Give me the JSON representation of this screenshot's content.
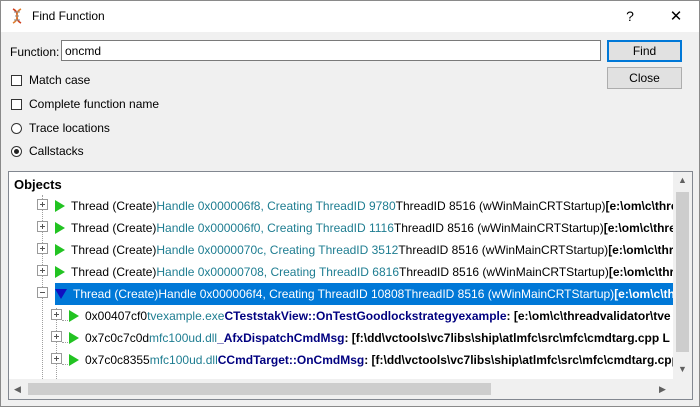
{
  "window": {
    "title": "Find Function",
    "help_glyph": "?",
    "close_glyph": "✕"
  },
  "form": {
    "function_label": "Function:",
    "function_value": "oncmd",
    "find_label": "Find",
    "close_label": "Close",
    "match_case": "Match case",
    "complete_name": "Complete function name",
    "trace_locations": "Trace locations",
    "callstacks": "Callstacks",
    "match_case_checked": false,
    "complete_name_checked": false,
    "selected_radio": "callstacks"
  },
  "objects": {
    "header": "Objects",
    "rows": [
      {
        "type": "thread",
        "a": "Thread (Create) ",
        "b": "Handle 0x000006f8, Creating ThreadID 9780 ",
        "c": "ThreadID 8516 (wWinMainCRTStartup) ",
        "d": "[e:\\om\\c\\threa"
      },
      {
        "type": "thread",
        "a": "Thread (Create) ",
        "b": "Handle 0x000006f0, Creating ThreadID 1116 ",
        "c": "ThreadID 8516 (wWinMainCRTStartup) ",
        "d": "[e:\\om\\c\\threa"
      },
      {
        "type": "thread",
        "a": "Thread (Create) ",
        "b": "Handle 0x0000070c, Creating ThreadID 3512 ",
        "c": "ThreadID 8516 (wWinMainCRTStartup) ",
        "d": "[e:\\om\\c\\threa"
      },
      {
        "type": "thread",
        "a": "Thread (Create) ",
        "b": "Handle 0x00000708, Creating ThreadID 6816 ",
        "c": "ThreadID 8516 (wWinMainCRTStartup) ",
        "d": "[e:\\om\\c\\threa"
      },
      {
        "type": "thread-selected",
        "a": "Thread (Create) ",
        "b": "Handle 0x000006f4, Creating ThreadID 10808 ",
        "c": "ThreadID 8516 (wWinMainCRTStartup) ",
        "d": "[e:\\om\\c\\thre"
      },
      {
        "type": "frame",
        "a": "0x00407cf0 ",
        "b": "tvexample.exe ",
        "c": "CTeststakView::OnTestGoodlockstrategyexample",
        "d": " : [e:\\om\\c\\threadvalidator\\tve"
      },
      {
        "type": "frame",
        "a": "0x7c0c7c0d ",
        "b": "mfc100ud.dll ",
        "c": "_AfxDispatchCmdMsg",
        "d": " : [f:\\dd\\vctools\\vc7libs\\ship\\atlmfc\\src\\mfc\\cmdtarg.cpp L"
      },
      {
        "type": "frame",
        "a": "0x7c0c8355 ",
        "b": "mfc100ud.dll ",
        "c": "CCmdTarget::OnCmdMsg",
        "d": " : [f:\\dd\\vctools\\vc7libs\\ship\\atlmfc\\src\\mfc\\cmdtarg.cpp"
      }
    ]
  },
  "colors": {
    "selection": "#0078d7",
    "teal_text": "#1e7d91",
    "navy_text": "#000080",
    "green_arrow": "#22c322"
  },
  "icons": {
    "app": "dna-icon",
    "expand": "plus-box-icon",
    "collapse": "minus-box-icon",
    "thread": "green-triangle-icon",
    "thread_open": "blue-triangle-down-icon"
  }
}
